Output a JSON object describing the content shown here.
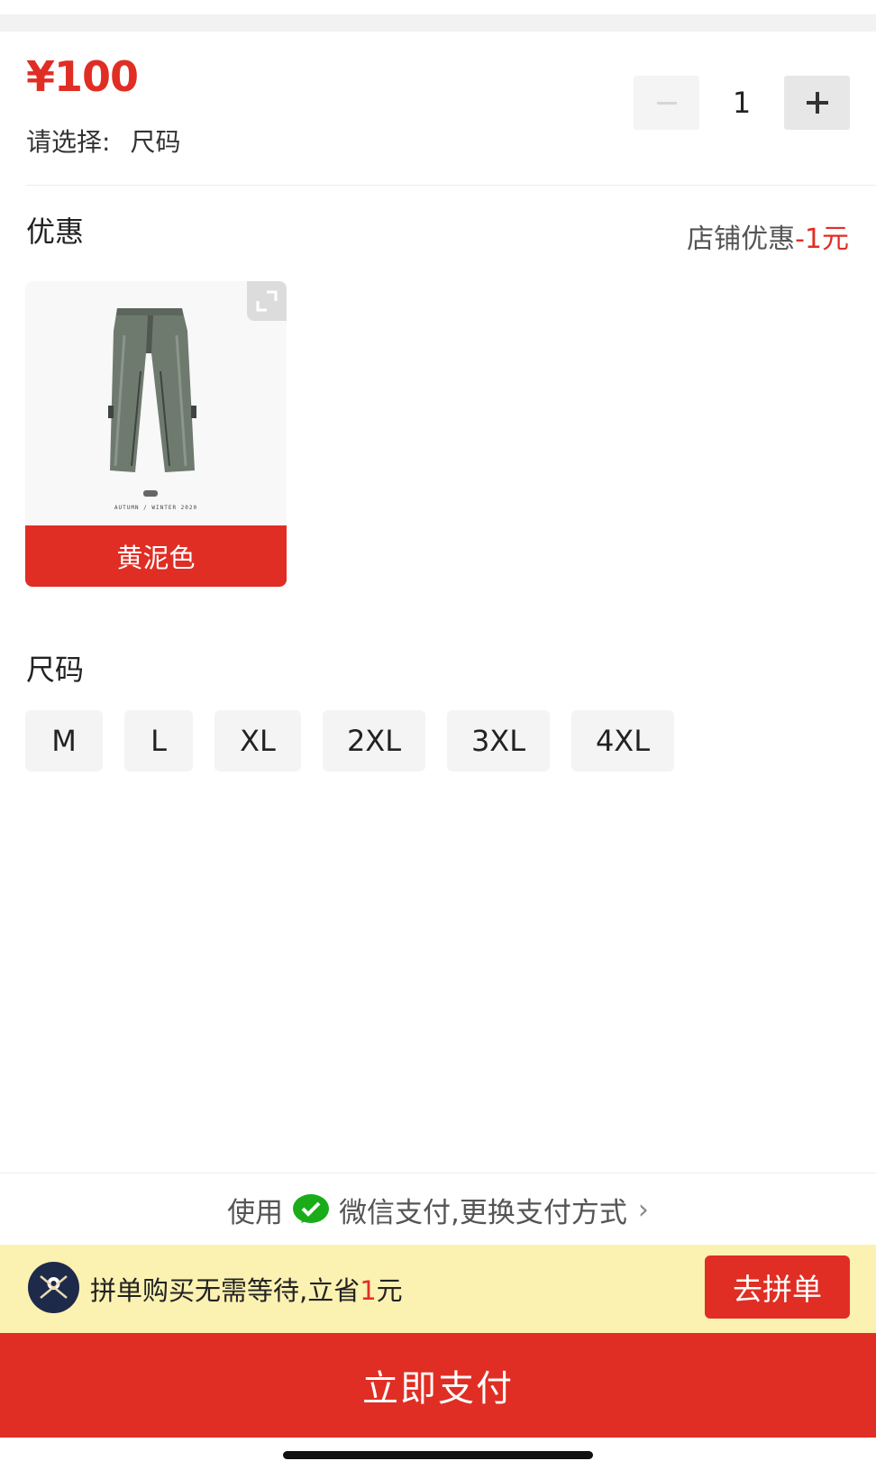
{
  "header": {
    "price": "¥100",
    "select_prompt": "请选择:",
    "select_value": "尺码"
  },
  "quantity": {
    "value": "1",
    "minus_icon": "minus-icon",
    "plus_icon": "plus-icon"
  },
  "discount": {
    "title": "优惠",
    "label": "店铺优惠",
    "amount": "-1元"
  },
  "sku": {
    "color_label": "黄泥色",
    "image_caption": "AUTUMN / WINTER 2020",
    "expand_icon": "expand-icon"
  },
  "size": {
    "title": "尺码",
    "options": [
      "M",
      "L",
      "XL",
      "2XL",
      "3XL",
      "4XL"
    ]
  },
  "payment": {
    "prefix": "使用",
    "method": "微信支付,更换支付方式",
    "icon": "wechat-pay-icon",
    "chevron": "chevron-right-icon"
  },
  "group_buy": {
    "text_before": "拼单购买无需等待,立省",
    "highlight": "1",
    "text_after": "元",
    "button": "去拼单"
  },
  "pay_button": "立即支付",
  "colors": {
    "accent": "#e02e24",
    "banner_bg": "#fbf1b1"
  }
}
